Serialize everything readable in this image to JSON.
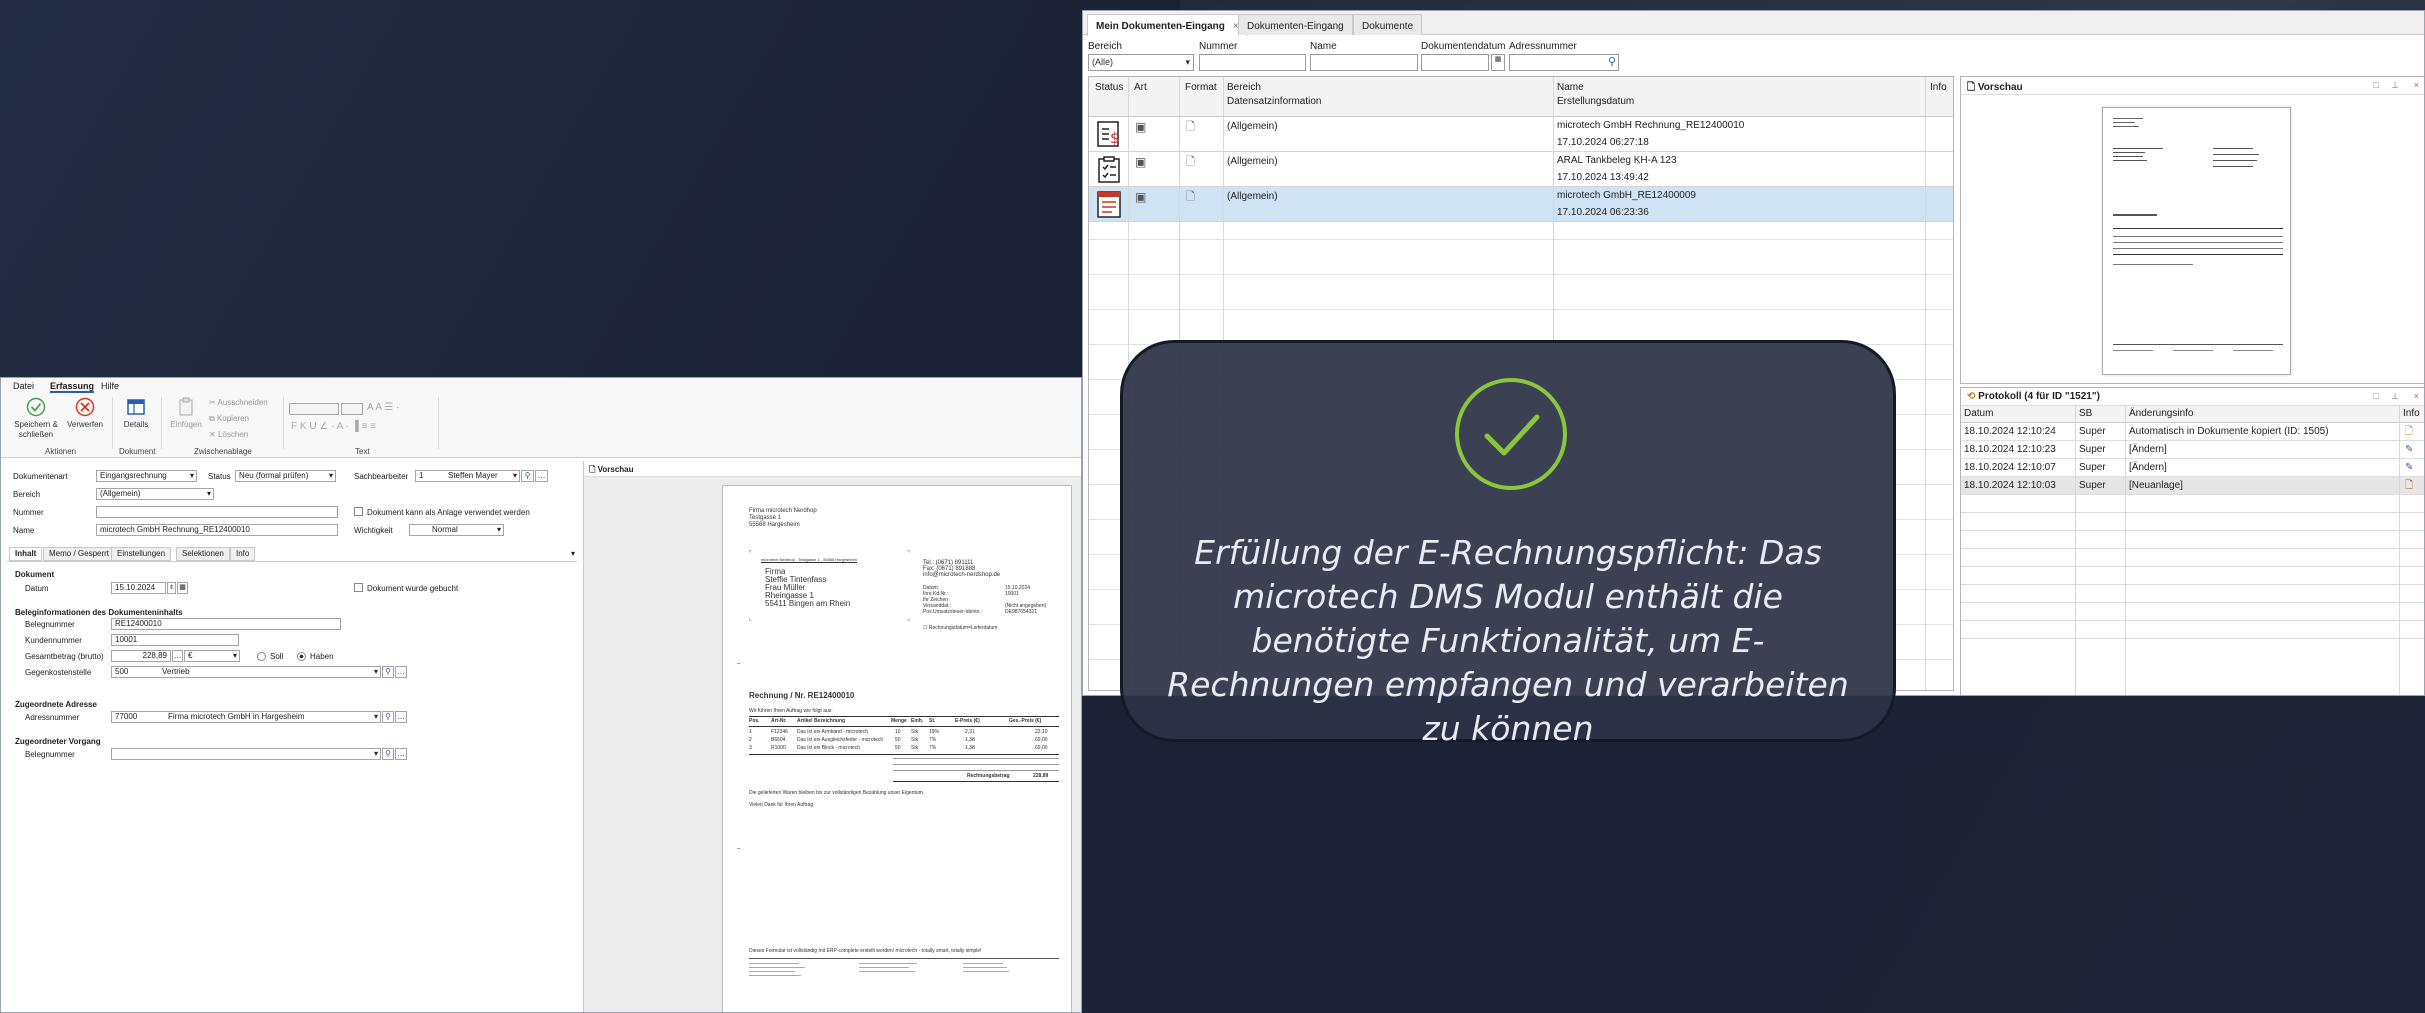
{
  "right_window": {
    "tabs": [
      {
        "label": "Mein Dokumenten-Eingang",
        "close": "×"
      },
      {
        "label": "Dokumenten-Eingang"
      },
      {
        "label": "Dokumente"
      }
    ],
    "filters": {
      "bereich_label": "Bereich",
      "bereich_value": "(Alle)",
      "nummer_label": "Nummer",
      "name_label": "Name",
      "datum_label": "Dokumentendatum",
      "adress_label": "Adressnummer"
    },
    "columns": {
      "status": "Status",
      "art": "Art",
      "format": "Format",
      "bereich": "Bereich",
      "datensatz": "Datensatzinformation",
      "name": "Name",
      "erstellung": "Erstellungsdatum",
      "info": "Info"
    },
    "rows": [
      {
        "bereich": "(Allgemein)",
        "name": "microtech GmbH Rechnung_RE12400010",
        "datum": "17.10.2024 06:27:18"
      },
      {
        "bereich": "(Allgemein)",
        "name": "ARAL Tankbeleg KH-A 123",
        "datum": "17.10.2024 13:49:42"
      },
      {
        "bereich": "(Allgemein)",
        "name": "microtech GmbH_RE12400009",
        "datum": "17.10.2024 06:23:36"
      }
    ],
    "vorschau_title": "Vorschau",
    "protokoll": {
      "title": "Protokoll (4 für ID \"1521\")",
      "columns": {
        "datum": "Datum",
        "sb": "SB",
        "info": "Änderungsinfo",
        "info2": "Info"
      },
      "rows": [
        {
          "datum": "18.10.2024 12:10:24",
          "sb": "Super",
          "info": "Automatisch in Dokumente kopiert (ID: 1505)"
        },
        {
          "datum": "18.10.2024 12:10:23",
          "sb": "Super",
          "info": "[Ändern]"
        },
        {
          "datum": "18.10.2024 12:10:07",
          "sb": "Super",
          "info": "[Ändern]"
        },
        {
          "datum": "18.10.2024 12:10:03",
          "sb": "Super",
          "info": "[Neuanlage]"
        }
      ]
    }
  },
  "left_window": {
    "menu": {
      "datei": "Datei",
      "erfassung": "Erfassung",
      "hilfe": "Hilfe"
    },
    "ribbon": {
      "save": "Speichern & schließen",
      "discard": "Verwerfen",
      "details": "Details",
      "paste": "Einfügen",
      "cut": "Ausschneiden",
      "copy": "Kopieren",
      "delete": "Löschen",
      "groups": {
        "aktionen": "Aktionen",
        "dokument": "Dokument",
        "zwischenablage": "Zwischenablage",
        "text": "Text"
      }
    },
    "form": {
      "dokumentenart_label": "Dokumentenart",
      "dokumentenart": "Eingangsrechnung",
      "status_label": "Status",
      "status": "Neu (formal prüfen)",
      "sachbearbeiter_label": "Sachbearbeiter",
      "sachbearbeiter_nr": "1",
      "sachbearbeiter": "Steffen Mayer",
      "bereich_label": "Bereich",
      "bereich": "(Allgemein)",
      "nummer_label": "Nummer",
      "name_label": "Name",
      "name": "microtech GmbH Rechnung_RE12400010",
      "anlage_label": "Dokument kann als Anlage verwendet werden",
      "wichtigkeit_label": "Wichtigkeit",
      "wichtigkeit": "Normal"
    },
    "subtabs": [
      "Inhalt",
      "Memo / Gesperrt",
      "Einstellungen",
      "Selektionen",
      "Info"
    ],
    "inhalt": {
      "dokument_section": "Dokument",
      "datum_label": "Datum",
      "datum": "15.10.2024",
      "gebucht_label": "Dokument wurde gebucht",
      "beleg_section": "Beleginformationen des Dokumenteninhalts",
      "belegnummer_label": "Belegnummer",
      "belegnummer": "RE12400010",
      "kundennummer_label": "Kundennummer",
      "kundennummer": "10001",
      "betrag_label": "Gesamtbetrag (brutto)",
      "betrag": "228,89",
      "waehrung": "€",
      "soll": "Soll",
      "haben": "Haben",
      "gegenkonto_label": "Gegenkostenstelle",
      "gegenkonto_nr": "500",
      "gegenkonto": "Vertrieb",
      "adresse_section": "Zugeordnete Adresse",
      "adressnummer_label": "Adressnummer",
      "adressnummer": "77000",
      "adresse": "Firma microtech GmbH in Hargesheim",
      "vorgang_section": "Zugeordneter Vorgang",
      "vorgang_beleg_label": "Belegnummer"
    },
    "vorschau_title": "Vorschau",
    "document": {
      "sender": "Firma microtech Nerdhop",
      "sender_street": "Testgasse 1",
      "sender_city": "55568 Hargesheim",
      "return_line": "microtech Nerdhop - Testgasse 1 - 55568 Hargesheim",
      "recipient": [
        "Firma",
        "Steffie Tintenfass",
        "Frau Müller",
        "Rheingasse 1",
        "55411 Bingen am Rhein"
      ],
      "contact": [
        "Tel.: (0671) 891111",
        "Fax: (0671) 891888",
        "info@microtech-nerdshop.de"
      ],
      "meta_labels": [
        "Datum:",
        "Ihre Kd.Nr.:",
        "Ihr Zeichen",
        "Versanddat.:",
        "Pos.Umsatzsteuer-Identn.:"
      ],
      "meta_values": [
        "15.10.2024",
        "10001",
        "",
        "(Nicht angegeben)",
        "DE987654321"
      ],
      "title": "Rechnung / Nr. RE12400010",
      "intro": "Wir führen Ihren Auftrag wie folgt aus:",
      "table_head": [
        "Pos.",
        "Art-Nr.",
        "Artikel Bezeichnung",
        "Menge",
        "Einh.",
        "St.",
        "E-Preis (€)",
        "Ges.-Preis (€)"
      ],
      "table_rows": [
        [
          "1",
          "F12346",
          "Das ist ein Armband - microtech",
          "10",
          "Stk",
          "19%",
          "2,31",
          "23,10"
        ],
        [
          "2",
          "B6604",
          "Das ist ein Ausgleichsfeder - microtech",
          "50",
          "Stk",
          "7%",
          "1,38",
          "69,00"
        ],
        [
          "3",
          "R1000",
          "Das ist ein Block - microtech",
          "50",
          "Stk",
          "7%",
          "1,38",
          "69,00"
        ]
      ],
      "totals_label": "Rechnungsbetrag",
      "totals_value": "228,89",
      "note": "Die gelieferten Waren bleiben bis zur vollständigen Bezahlung unser Eigentum.",
      "thanks": "Vielen Dank für Ihren Auftrag.",
      "footer": "Dieses Formular ist vollständig mit ERP-complete erstellt worden! microtech - totally smart, totally simple!"
    }
  },
  "overlay": {
    "text": "Erfüllung der E-Rechnungspflicht: Das microtech DMS Modul enthält die benötigte Funktionalität, um E-Rechnungen empfangen und verarbeiten zu können",
    "icon": "checkmark-circle-icon",
    "accent_color": "#8cc63f"
  }
}
